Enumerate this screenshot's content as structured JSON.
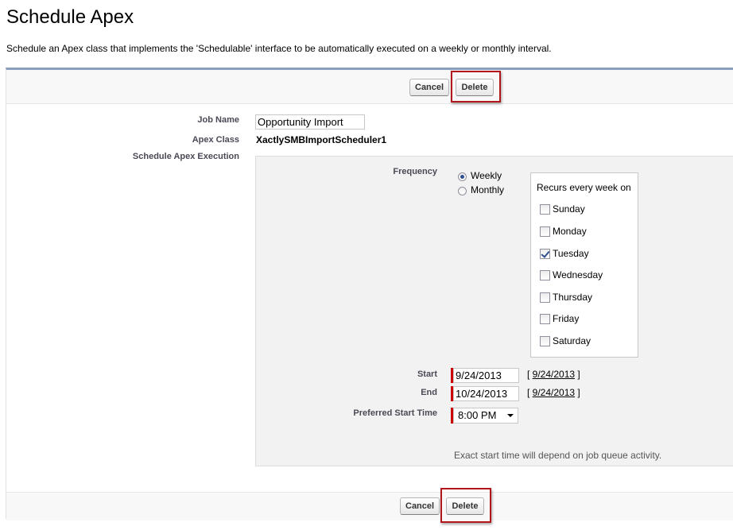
{
  "page": {
    "title": "Schedule Apex",
    "description": "Schedule an Apex class that implements the 'Schedulable' interface to be automatically executed on a weekly or monthly interval."
  },
  "buttons": {
    "cancel": "Cancel",
    "delete": "Delete"
  },
  "form": {
    "job_name_label": "Job Name",
    "job_name_value": "Opportunity Import",
    "apex_class_label": "Apex Class",
    "apex_class_value": "XactlySMBImportScheduler1",
    "schedule_label": "Schedule Apex Execution"
  },
  "schedule": {
    "frequency_label": "Frequency",
    "frequency_options": [
      "Weekly",
      "Monthly"
    ],
    "frequency_selected": "Weekly",
    "recurs_title": "Recurs every week on",
    "days": [
      {
        "name": "Sunday",
        "checked": false
      },
      {
        "name": "Monday",
        "checked": false
      },
      {
        "name": "Tuesday",
        "checked": true
      },
      {
        "name": "Wednesday",
        "checked": false
      },
      {
        "name": "Thursday",
        "checked": false
      },
      {
        "name": "Friday",
        "checked": false
      },
      {
        "name": "Saturday",
        "checked": false
      }
    ],
    "start_label": "Start",
    "start_value": "9/24/2013",
    "start_link": "9/24/2013",
    "end_label": "End",
    "end_value": "10/24/2013",
    "end_link": "9/24/2013",
    "preferred_label": "Preferred Start Time",
    "preferred_value": "8:00 PM",
    "note": "Exact start time will depend on job queue activity."
  },
  "colors": {
    "highlight": "#b3151d",
    "required": "#cc0000",
    "panel_border": "#8a9ebe"
  }
}
